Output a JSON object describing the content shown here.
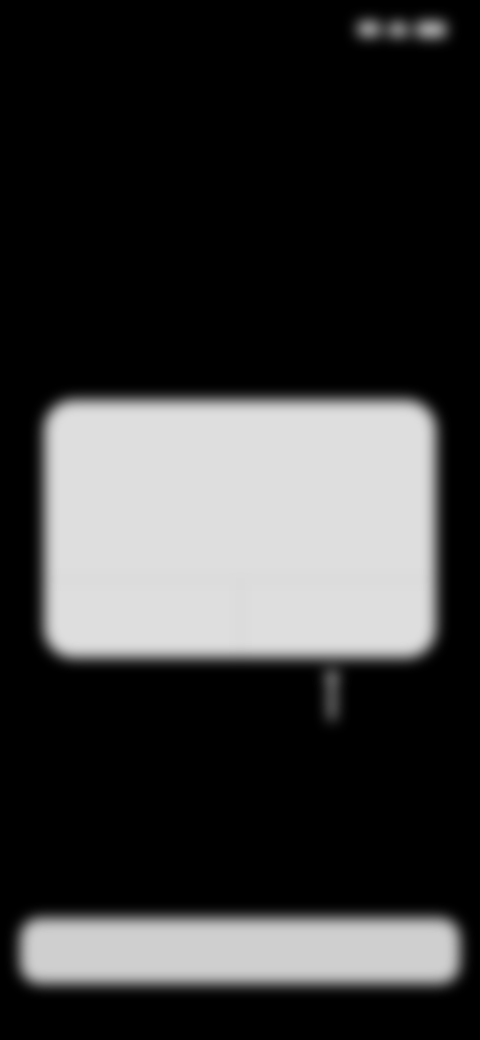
{
  "status_bar": {
    "time": "",
    "icons": [
      "signal-icon",
      "wifi-icon",
      "battery-icon"
    ]
  },
  "header": {
    "title": ""
  },
  "prompt": {
    "text": ""
  },
  "alert": {
    "title": "",
    "message": "",
    "buttons": [
      {
        "label": ""
      },
      {
        "label": ""
      }
    ]
  },
  "bottom_button": {
    "label": ""
  },
  "colors": {
    "background": "#000000",
    "dialog": "#dedede",
    "button": "#cfcfcf"
  }
}
